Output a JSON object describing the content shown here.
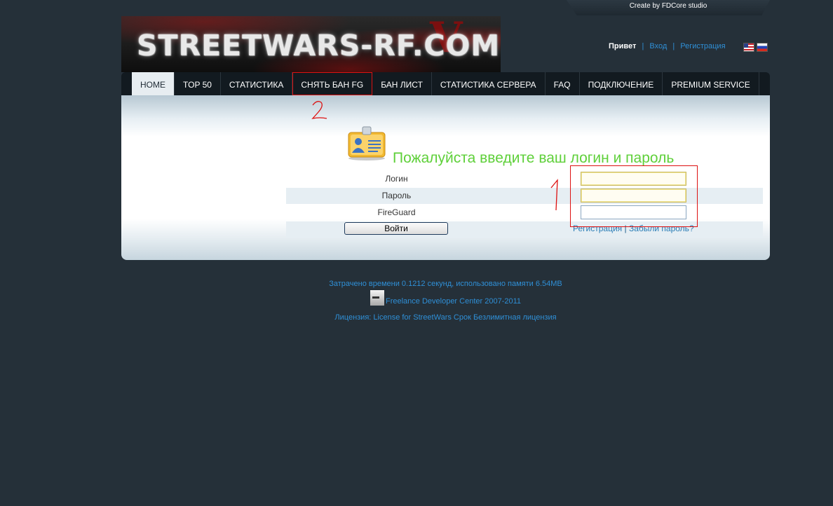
{
  "credit": {
    "text": "Create by FDCore studio"
  },
  "logo": {
    "text": "STREETWARS-RF.COM"
  },
  "toplinks": {
    "greeting": "Привет",
    "separator": "|",
    "login": "Вход",
    "register": "Регистрация",
    "flags": [
      "us-flag-icon",
      "ru-flag-icon"
    ]
  },
  "nav": {
    "items": [
      {
        "label": "HOME"
      },
      {
        "label": "TOP 50"
      },
      {
        "label": "СТАТИСТИКА"
      },
      {
        "label": "СНЯТЬ БАН FG"
      },
      {
        "label": "БАН ЛИСТ"
      },
      {
        "label": "СТАТИСТИКА СЕРВЕРА"
      },
      {
        "label": "FAQ"
      },
      {
        "label": "ПОДКЛЮЧЕНИЕ"
      },
      {
        "label": "PREMIUM SERVICE"
      }
    ],
    "active": "HOME"
  },
  "login": {
    "heading": "Пожалуйста введите ваш логин и пароль",
    "icon": "user-card-icon",
    "fields": {
      "login_label": "Логин",
      "login_value": "",
      "password_label": "Пароль",
      "password_value": "",
      "fireguard_label": "FireGuard",
      "fireguard_value": ""
    },
    "submit_label": "Войти",
    "register_link": "Регистрация",
    "link_separator": "|",
    "forgot_link": "Забыли пароль?"
  },
  "annotations": {
    "mark1": "1",
    "mark2": "2"
  },
  "footer": {
    "timing": "Затрачено времени 0.1212 секунд, использовано памяти 6.54MB",
    "developer": "Freelance Developer Center 2007-2011",
    "license": "Лицензия: License for StreetWars Срок Безлимитная лицензия"
  },
  "colors": {
    "background": "#253039",
    "nav_bg": "#121a20",
    "heading_green": "#5fd03a",
    "link_blue": "#2f8fd6",
    "annotation_red": "#dd1111"
  }
}
